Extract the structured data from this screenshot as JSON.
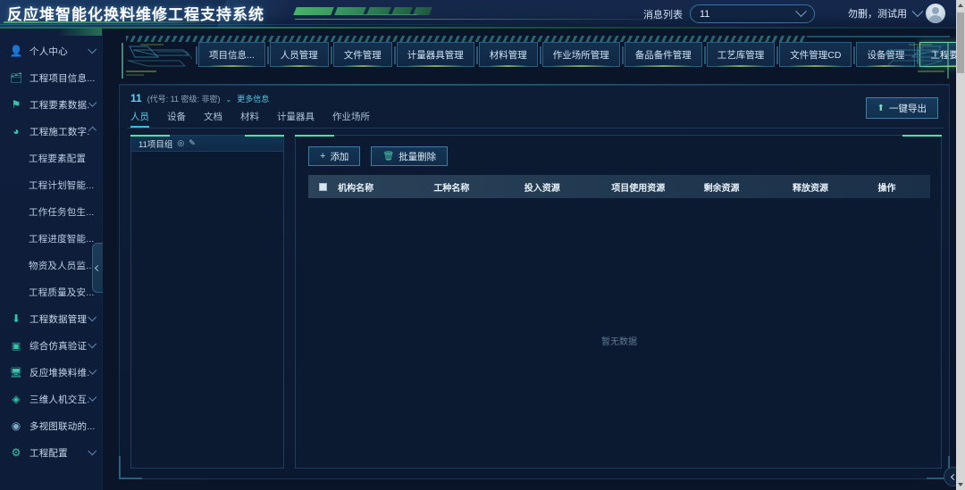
{
  "header": {
    "title": "反应堆智能化换料维修工程支持系统",
    "message_label": "消息列表",
    "message_value": "11",
    "user_name": "勿删，测试用",
    "avatar_icon": "user-avatar-icon",
    "chevron_icon": "chevron-down-icon"
  },
  "sidebar": {
    "items": [
      {
        "label": "个人中心",
        "icon": "person-icon",
        "expandable": true,
        "expanded": false
      },
      {
        "label": "工程项目信息...",
        "icon": "id-card-icon",
        "expandable": false,
        "expanded": false
      },
      {
        "label": "工程要素数据...",
        "icon": "flag-icon",
        "expandable": true,
        "expanded": false
      },
      {
        "label": "工程施工数字...",
        "icon": "pie-chart-icon",
        "expandable": true,
        "expanded": true
      },
      {
        "label": "工程数据管理",
        "icon": "download-icon",
        "expandable": true,
        "expanded": false
      },
      {
        "label": "综合仿真验证",
        "icon": "frame-icon",
        "expandable": true,
        "expanded": false
      },
      {
        "label": "反应堆换料维...",
        "icon": "monitor-icon",
        "expandable": true,
        "expanded": false
      },
      {
        "label": "三维人机交互...",
        "icon": "cubes-icon",
        "expandable": true,
        "expanded": false
      },
      {
        "label": "多视图联动的...",
        "icon": "eye-icon",
        "expandable": false,
        "expanded": false
      },
      {
        "label": "工程配置",
        "icon": "gear-icon",
        "expandable": true,
        "expanded": false
      }
    ],
    "submenu_after_index": 3,
    "submenu": [
      {
        "label": "工程要素配置"
      },
      {
        "label": "工程计划智能..."
      },
      {
        "label": "工作任务包生..."
      },
      {
        "label": "工程进度智能..."
      },
      {
        "label": "物资及人员监..."
      },
      {
        "label": "工程质量及安..."
      }
    ],
    "collapse_icon": "chevron-left-icon"
  },
  "tabs": {
    "prev_icon": "chevron-left-icon",
    "next_icon": "chevron-right-icon",
    "items": [
      {
        "label": "项目信息...",
        "active": false,
        "closable": false
      },
      {
        "label": "人员管理",
        "active": false,
        "closable": false
      },
      {
        "label": "文件管理",
        "active": false,
        "closable": false
      },
      {
        "label": "计量器具管理",
        "active": false,
        "closable": false
      },
      {
        "label": "材料管理",
        "active": false,
        "closable": false
      },
      {
        "label": "作业场所管理",
        "active": false,
        "closable": false
      },
      {
        "label": "备品备件管理",
        "active": false,
        "closable": false
      },
      {
        "label": "工艺库管理",
        "active": false,
        "closable": false
      },
      {
        "label": "文件管理CD",
        "active": false,
        "closable": false
      },
      {
        "label": "设备管理",
        "active": false,
        "closable": false
      },
      {
        "label": "工程要素配置",
        "active": true,
        "closable": true,
        "close_label": "×"
      }
    ]
  },
  "project": {
    "id": "11",
    "meta": "(代号: 11 密级: 非密)",
    "more_info": "更多信息",
    "more_info_chevron": "chevron-down-icon",
    "subtabs": [
      {
        "label": "人员",
        "active": true
      },
      {
        "label": "设备",
        "active": false
      },
      {
        "label": "文档",
        "active": false
      },
      {
        "label": "材料",
        "active": false
      },
      {
        "label": "计量器具",
        "active": false
      },
      {
        "label": "作业场所",
        "active": false
      }
    ],
    "export_button": "一键导出",
    "export_icon": "upload-icon"
  },
  "tree_panel": {
    "root_label": "11项目组",
    "add_icon": "plus-circle-icon",
    "edit_icon": "pencil-icon"
  },
  "table_panel": {
    "add_button": "添加",
    "add_icon": "plus-icon",
    "delete_button": "批量删除",
    "delete_icon": "trash-icon",
    "select_all_icon": "checkbox-icon",
    "columns": [
      "机构名称",
      "工种名称",
      "投入资源",
      "项目使用资源",
      "剩余资源",
      "释放资源",
      "操作"
    ],
    "rows": [],
    "empty_text": "暂无数据"
  },
  "floating_button": {
    "icon": "chevron-left-icon"
  },
  "colors": {
    "accent_cyan": "#4fd2ea",
    "accent_green": "#6fd6a8",
    "tab_active_border": "#6fd6a8",
    "panel_bg": "#0b1a31",
    "app_bg": "#0a1529",
    "header_bg": "#15284b",
    "text_primary": "#dcecf8",
    "text_muted": "#8fa9c2"
  }
}
